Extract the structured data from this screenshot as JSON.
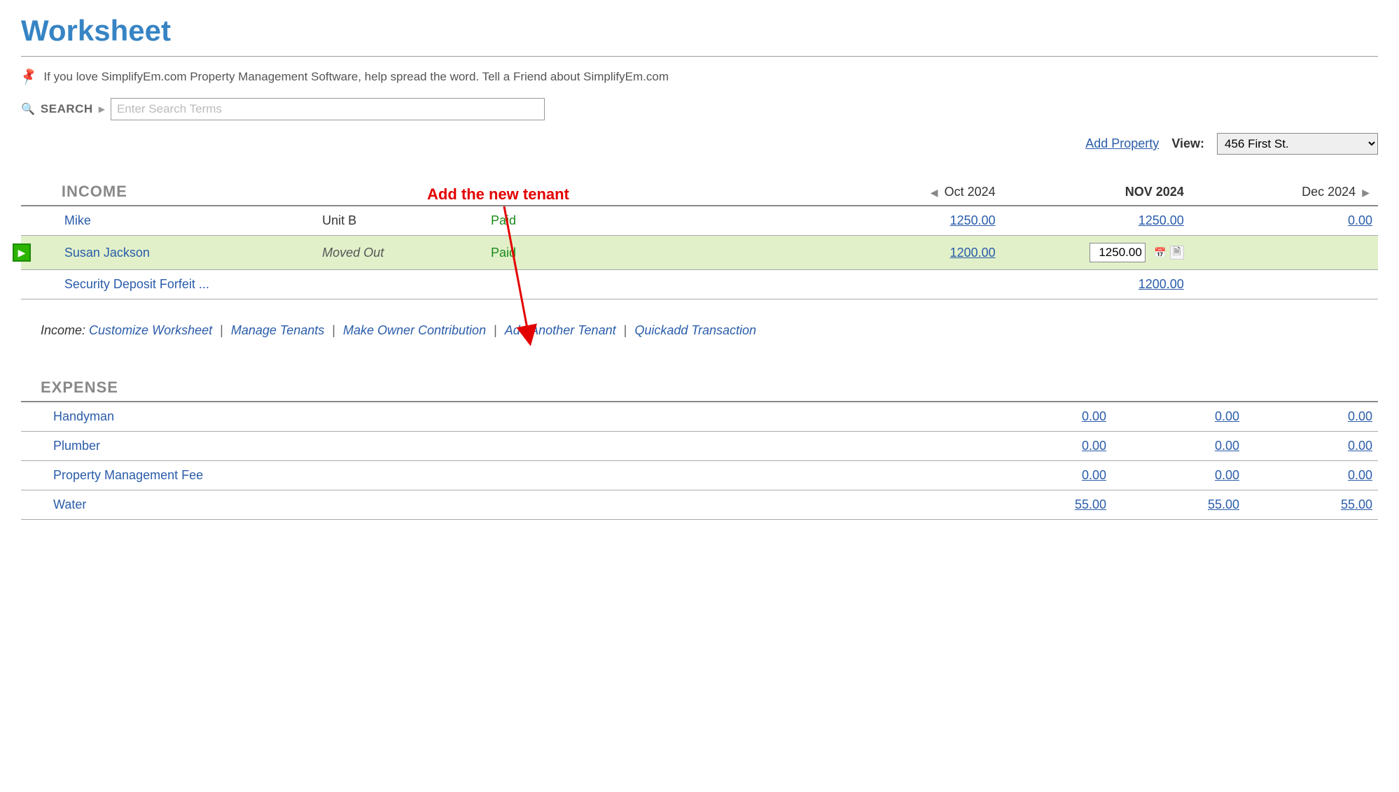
{
  "page": {
    "title": "Worksheet",
    "promo": "If you love SimplifyEm.com Property Management Software, help spread the word. Tell a Friend about SimplifyEm.com"
  },
  "search": {
    "label": "SEARCH",
    "placeholder": "Enter Search Terms"
  },
  "topbar": {
    "add_property": "Add Property",
    "view_label": "View:",
    "view_selected": "456 First St."
  },
  "annotation": {
    "text": "Add the new tenant"
  },
  "months": {
    "prev": "Oct 2024",
    "current": "NOV 2024",
    "next": "Dec 2024"
  },
  "sections": {
    "income_header": "INCOME",
    "expense_header": "EXPENSE"
  },
  "income_rows": {
    "mike": {
      "name": "Mike",
      "unit": "Unit B",
      "status": "Paid",
      "oct": "1250.00",
      "nov": "1250.00",
      "dec": "0.00"
    },
    "susan": {
      "name": "Susan Jackson",
      "unit": "Moved Out",
      "status": "Paid",
      "oct": "1200.00",
      "nov_value": "1250.00",
      "dec": ""
    },
    "deposit": {
      "name": "Security Deposit Forfeit  ...",
      "nov": "1200.00"
    }
  },
  "income_links": {
    "label": "Income:",
    "customize": "Customize Worksheet",
    "manage": "Manage Tenants",
    "contribution": "Make Owner Contribution",
    "add_tenant": "Add Another Tenant",
    "quickadd": "Quickadd Transaction"
  },
  "expense_rows": {
    "handyman": {
      "name": "Handyman",
      "oct": "0.00",
      "nov": "0.00",
      "dec": "0.00"
    },
    "plumber": {
      "name": "Plumber",
      "oct": "0.00",
      "nov": "0.00",
      "dec": "0.00"
    },
    "pmfee": {
      "name": "Property Management Fee",
      "oct": "0.00",
      "nov": "0.00",
      "dec": "0.00"
    },
    "water": {
      "name": "Water",
      "oct": "55.00",
      "nov": "55.00",
      "dec": "55.00"
    }
  }
}
